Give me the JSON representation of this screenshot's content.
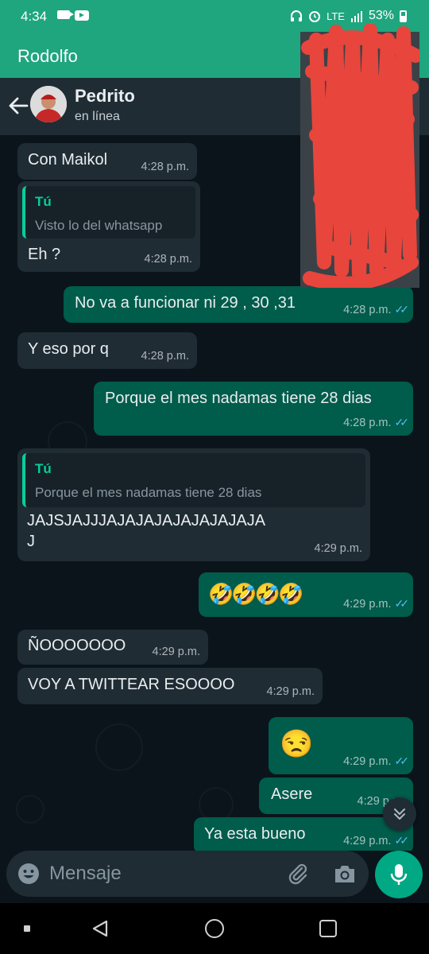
{
  "status_bar": {
    "time": "4:34",
    "lte_label": "LTE",
    "battery": "53%"
  },
  "background_app": {
    "title": "Rodolfo"
  },
  "chat_header": {
    "contact_name": "Pedrito",
    "contact_status": "en línea"
  },
  "messages": [
    {
      "direction": "incoming",
      "text": "Con Maikol",
      "time": "4:28 p.m."
    },
    {
      "direction": "incoming",
      "quote_author": "Tú",
      "quote_text": "Visto lo del whatsapp",
      "text": "Eh ?",
      "time": "4:28 p.m."
    },
    {
      "direction": "outgoing",
      "text": "No va a funcionar ni 29 , 30 ,31",
      "time": "4:28 p.m.",
      "status": "read"
    },
    {
      "direction": "incoming",
      "text": "Y eso por q",
      "time": "4:28 p.m."
    },
    {
      "direction": "outgoing",
      "text": "Porque el mes nadamas tiene 28 dias",
      "time": "4:28 p.m.",
      "status": "read"
    },
    {
      "direction": "incoming",
      "quote_author": "Tú",
      "quote_text": "Porque el mes nadamas tiene 28 dias",
      "text_line1": "JAJSJAJJJAJAJAJAJAJAJAJAJA",
      "text_line2": "J",
      "time": "4:29 p.m."
    },
    {
      "direction": "outgoing",
      "text": "🤣🤣🤣🤣",
      "time": "4:29 p.m.",
      "status": "read"
    },
    {
      "direction": "incoming",
      "text": "ÑOOOOOOO",
      "time": "4:29 p.m."
    },
    {
      "direction": "incoming",
      "text": "VOY A TWITTEAR ESOOOO",
      "time": "4:29 p.m."
    },
    {
      "direction": "outgoing",
      "text": "😒",
      "time": "4:29 p.m.",
      "status": "read"
    },
    {
      "direction": "outgoing",
      "text": "Asere",
      "time": "4:29 p.m."
    },
    {
      "direction": "outgoing",
      "text": "Ya esta bueno",
      "time": "4:29 p.m.",
      "status": "read"
    }
  ],
  "composer": {
    "placeholder": "Mensaje"
  },
  "icons": {
    "back": "arrow-left-icon",
    "emoji": "emoji-icon",
    "attach": "paperclip-icon",
    "camera": "camera-icon",
    "mic": "microphone-icon",
    "scroll_down": "double-chevron-down-icon"
  },
  "colors": {
    "status_bar": "#1fa67e",
    "header": "#1f2c34",
    "chat_bg": "#0b141a",
    "incoming_bubble": "#1f2c34",
    "outgoing_bubble": "#005c4b",
    "accent": "#00a884",
    "read_ticks": "#53bdeb",
    "scribble": "#e8453c"
  }
}
